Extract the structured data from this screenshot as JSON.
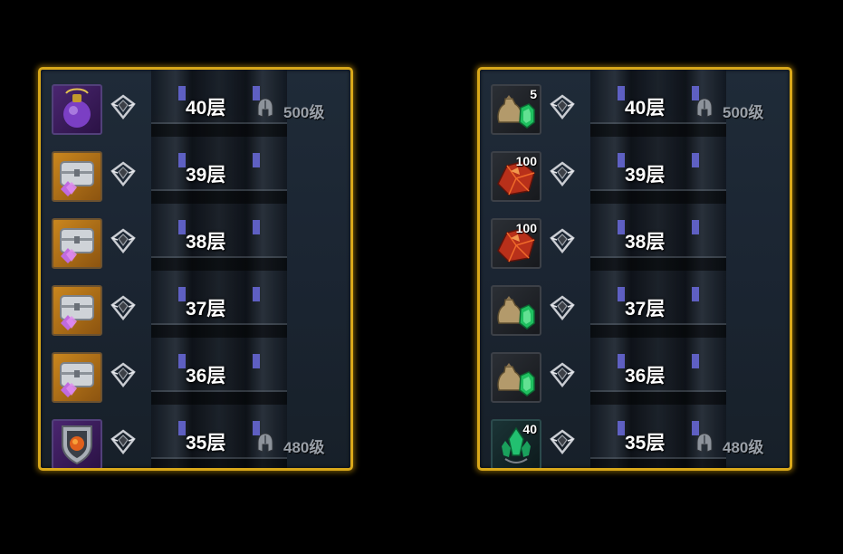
{
  "left_panel": {
    "rows": [
      {
        "floor": "40层",
        "item": "purple-potion-icon",
        "quantity": "",
        "level": "500级"
      },
      {
        "floor": "39层",
        "item": "silver-chest-icon",
        "quantity": "",
        "level": ""
      },
      {
        "floor": "38层",
        "item": "silver-chest-icon",
        "quantity": "",
        "level": ""
      },
      {
        "floor": "37层",
        "item": "silver-chest-icon",
        "quantity": "",
        "level": ""
      },
      {
        "floor": "36层",
        "item": "silver-chest-icon",
        "quantity": "",
        "level": ""
      },
      {
        "floor": "35层",
        "item": "shield-emblem-icon",
        "quantity": "",
        "level": "480级"
      }
    ]
  },
  "right_panel": {
    "rows": [
      {
        "floor": "40层",
        "item": "money-bag-gem-icon",
        "quantity": "5",
        "level": "500级"
      },
      {
        "floor": "39层",
        "item": "red-ore-icon",
        "quantity": "100",
        "level": ""
      },
      {
        "floor": "38层",
        "item": "red-ore-icon",
        "quantity": "100",
        "level": ""
      },
      {
        "floor": "37层",
        "item": "money-bag-gem-icon",
        "quantity": "",
        "level": ""
      },
      {
        "floor": "36层",
        "item": "money-bag-gem-icon",
        "quantity": "",
        "level": ""
      },
      {
        "floor": "35层",
        "item": "green-crystal-icon",
        "quantity": "40",
        "level": "480级"
      }
    ]
  },
  "colors": {
    "frame": "#d9a81a",
    "panel_bg": "#1b2532",
    "floor_text": "#ffffff",
    "level_text": "#9aa0a8"
  }
}
